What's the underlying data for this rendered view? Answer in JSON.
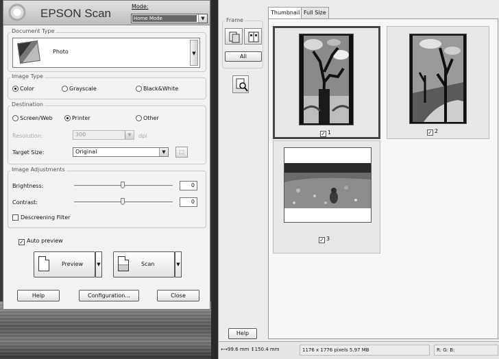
{
  "left": {
    "app_title": "EPSON Scan",
    "mode_label": "Mode:",
    "mode_value": "Home Mode",
    "document_type": {
      "title": "Document Type",
      "value": "Photo"
    },
    "image_type": {
      "title": "Image Type",
      "options": [
        {
          "label": "Color",
          "selected": true
        },
        {
          "label": "Grayscale",
          "selected": false
        },
        {
          "label": "Black&White",
          "selected": false
        }
      ]
    },
    "destination": {
      "title": "Destination",
      "options": [
        {
          "label": "Screen/Web",
          "selected": false
        },
        {
          "label": "Printer",
          "selected": true
        },
        {
          "label": "Other",
          "selected": false
        }
      ],
      "resolution_label": "Resolution:",
      "resolution_value": "300",
      "resolution_unit": "dpi",
      "target_size_label": "Target Size:",
      "target_size_value": "Original"
    },
    "image_adjustments": {
      "title": "Image Adjustments",
      "brightness_label": "Brightness:",
      "brightness_value": "0",
      "contrast_label": "Contrast:",
      "contrast_value": "0",
      "descreening_label": "Descreening Filter",
      "descreening_checked": false
    },
    "auto_preview_label": "Auto preview",
    "auto_preview_checked": true,
    "preview_label": "Preview",
    "scan_label": "Scan",
    "help_label": "Help",
    "configuration_label": "Configuration...",
    "close_label": "Close"
  },
  "right": {
    "frame_title": "Frame",
    "all_label": "All",
    "tabs": [
      {
        "label": "Thumbnail",
        "active": true
      },
      {
        "label": "Full Size",
        "active": false
      }
    ],
    "thumbnails": [
      {
        "number": "1",
        "checked": true,
        "selected": true
      },
      {
        "number": "2",
        "checked": true,
        "selected": false
      },
      {
        "number": "3",
        "checked": true,
        "selected": false
      }
    ],
    "help_label": "Help",
    "status": {
      "width": "99.6 mm",
      "height": "150.4 mm",
      "pixels": "1176 x 1776 pixels 5.97 MB",
      "rgb": "R: G: B:"
    }
  }
}
